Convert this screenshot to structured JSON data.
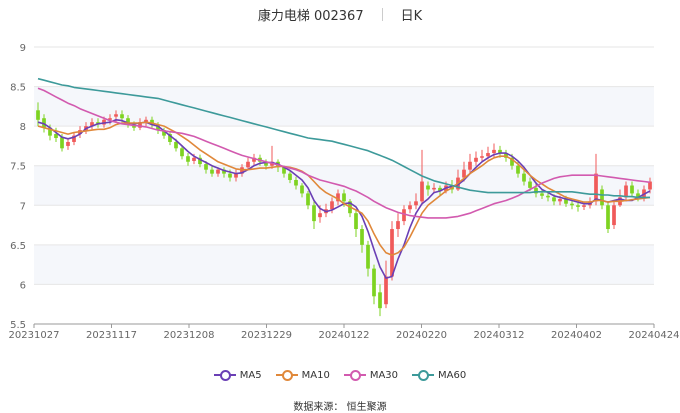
{
  "header": {
    "stock": "康力电梯 002367",
    "period": "日K"
  },
  "source": "数据来源： 恒生聚源",
  "chart_data": {
    "type": "candlestick",
    "y_ticks": [
      "5.5",
      "6",
      "6.5",
      "7",
      "7.5",
      "8",
      "8.5",
      "9"
    ],
    "ylim": [
      5.5,
      9
    ],
    "x_tick_labels": [
      "20231027",
      "20231117",
      "20231208",
      "20231229",
      "20240122",
      "20240220",
      "20240312",
      "20240402",
      "20240424"
    ],
    "colors": {
      "up": "#f05a5a",
      "down": "#7ed321",
      "MA5": "#6a3fb5",
      "MA10": "#e0883a",
      "MA30": "#d25aaf",
      "MA60": "#3d9a9a",
      "grid": "#e6e6e6",
      "band": "#f5f7fb"
    },
    "candles": [
      [
        8.2,
        8.08,
        8.3,
        8.0
      ],
      [
        8.1,
        7.98,
        8.15,
        7.92
      ],
      [
        7.98,
        7.88,
        8.02,
        7.82
      ],
      [
        7.9,
        7.85,
        7.98,
        7.8
      ],
      [
        7.86,
        7.72,
        7.9,
        7.68
      ],
      [
        7.75,
        7.8,
        7.85,
        7.7
      ],
      [
        7.8,
        7.88,
        7.92,
        7.76
      ],
      [
        7.9,
        7.95,
        8.0,
        7.85
      ],
      [
        7.95,
        8.0,
        8.05,
        7.9
      ],
      [
        8.0,
        8.05,
        8.1,
        7.96
      ],
      [
        8.05,
        8.02,
        8.1,
        7.98
      ],
      [
        8.02,
        8.08,
        8.12,
        7.98
      ],
      [
        8.08,
        8.1,
        8.15,
        8.02
      ],
      [
        8.12,
        8.15,
        8.2,
        8.05
      ],
      [
        8.15,
        8.1,
        8.2,
        8.05
      ],
      [
        8.1,
        8.02,
        8.14,
        7.98
      ],
      [
        8.02,
        7.98,
        8.06,
        7.94
      ],
      [
        7.98,
        8.05,
        8.1,
        7.95
      ],
      [
        8.05,
        8.08,
        8.12,
        8.0
      ],
      [
        8.08,
        8.02,
        8.12,
        7.98
      ],
      [
        8.02,
        7.95,
        8.05,
        7.9
      ],
      [
        7.95,
        7.88,
        7.98,
        7.84
      ],
      [
        7.9,
        7.8,
        7.92,
        7.76
      ],
      [
        7.8,
        7.72,
        7.84,
        7.68
      ],
      [
        7.72,
        7.62,
        7.75,
        7.58
      ],
      [
        7.62,
        7.55,
        7.66,
        7.5
      ],
      [
        7.56,
        7.6,
        7.65,
        7.52
      ],
      [
        7.6,
        7.52,
        7.64,
        7.48
      ],
      [
        7.52,
        7.45,
        7.56,
        7.4
      ],
      [
        7.45,
        7.4,
        7.5,
        7.36
      ],
      [
        7.4,
        7.45,
        7.48,
        7.36
      ],
      [
        7.45,
        7.4,
        7.48,
        7.35
      ],
      [
        7.4,
        7.35,
        7.45,
        7.3
      ],
      [
        7.35,
        7.4,
        7.45,
        7.3
      ],
      [
        7.4,
        7.48,
        7.52,
        7.36
      ],
      [
        7.48,
        7.55,
        7.6,
        7.44
      ],
      [
        7.55,
        7.6,
        7.65,
        7.5
      ],
      [
        7.6,
        7.55,
        7.64,
        7.5
      ],
      [
        7.55,
        7.5,
        7.58,
        7.45
      ],
      [
        7.5,
        7.55,
        7.75,
        7.46
      ],
      [
        7.55,
        7.48,
        7.58,
        7.42
      ],
      [
        7.48,
        7.4,
        7.5,
        7.35
      ],
      [
        7.4,
        7.32,
        7.44,
        7.28
      ],
      [
        7.32,
        7.25,
        7.36,
        7.2
      ],
      [
        7.25,
        7.15,
        7.28,
        7.1
      ],
      [
        7.15,
        7.0,
        7.18,
        6.95
      ],
      [
        7.0,
        6.8,
        7.05,
        6.7
      ],
      [
        6.85,
        6.9,
        7.0,
        6.78
      ],
      [
        6.9,
        6.95,
        7.02,
        6.85
      ],
      [
        6.95,
        7.05,
        7.1,
        6.9
      ],
      [
        7.05,
        7.15,
        7.2,
        7.0
      ],
      [
        7.15,
        7.05,
        7.2,
        6.98
      ],
      [
        7.05,
        6.9,
        7.08,
        6.85
      ],
      [
        6.9,
        6.7,
        6.95,
        6.6
      ],
      [
        6.7,
        6.5,
        6.75,
        6.4
      ],
      [
        6.5,
        6.2,
        6.55,
        6.1
      ],
      [
        6.2,
        5.85,
        6.25,
        5.75
      ],
      [
        5.9,
        5.7,
        6.0,
        5.6
      ],
      [
        5.75,
        6.1,
        6.3,
        5.7
      ],
      [
        6.1,
        6.7,
        6.8,
        6.05
      ],
      [
        6.7,
        6.8,
        6.9,
        6.6
      ],
      [
        6.8,
        6.95,
        7.0,
        6.75
      ],
      [
        6.95,
        7.0,
        7.05,
        6.9
      ],
      [
        7.0,
        7.05,
        7.15,
        6.95
      ],
      [
        7.05,
        7.3,
        7.7,
        7.0
      ],
      [
        7.25,
        7.2,
        7.3,
        7.12
      ],
      [
        7.2,
        7.22,
        7.28,
        7.15
      ],
      [
        7.22,
        7.18,
        7.25,
        7.12
      ],
      [
        7.18,
        7.25,
        7.3,
        7.15
      ],
      [
        7.25,
        7.2,
        7.32,
        7.15
      ],
      [
        7.2,
        7.35,
        7.45,
        7.18
      ],
      [
        7.35,
        7.45,
        7.55,
        7.3
      ],
      [
        7.45,
        7.55,
        7.65,
        7.4
      ],
      [
        7.55,
        7.6,
        7.68,
        7.5
      ],
      [
        7.6,
        7.62,
        7.7,
        7.55
      ],
      [
        7.62,
        7.66,
        7.74,
        7.58
      ],
      [
        7.66,
        7.7,
        7.78,
        7.6
      ],
      [
        7.7,
        7.66,
        7.75,
        7.6
      ],
      [
        7.66,
        7.6,
        7.7,
        7.55
      ],
      [
        7.6,
        7.5,
        7.65,
        7.45
      ],
      [
        7.5,
        7.4,
        7.55,
        7.35
      ],
      [
        7.4,
        7.3,
        7.45,
        7.25
      ],
      [
        7.3,
        7.22,
        7.35,
        7.18
      ],
      [
        7.22,
        7.15,
        7.28,
        7.1
      ],
      [
        7.15,
        7.12,
        7.2,
        7.08
      ],
      [
        7.12,
        7.1,
        7.16,
        7.05
      ],
      [
        7.1,
        7.05,
        7.14,
        7.0
      ],
      [
        7.05,
        7.08,
        7.12,
        7.0
      ],
      [
        7.08,
        7.02,
        7.12,
        6.98
      ],
      [
        7.02,
        7.0,
        7.06,
        6.95
      ],
      [
        7.0,
        6.98,
        7.05,
        6.92
      ],
      [
        6.98,
        7.0,
        7.04,
        6.94
      ],
      [
        7.0,
        7.05,
        7.1,
        6.96
      ],
      [
        7.05,
        7.4,
        7.65,
        7.0
      ],
      [
        7.2,
        7.0,
        7.25,
        6.95
      ],
      [
        7.0,
        6.7,
        7.05,
        6.65
      ],
      [
        6.75,
        7.0,
        7.05,
        6.7
      ],
      [
        7.0,
        7.1,
        7.2,
        6.98
      ],
      [
        7.1,
        7.25,
        7.3,
        7.05
      ],
      [
        7.25,
        7.15,
        7.3,
        7.1
      ],
      [
        7.15,
        7.1,
        7.2,
        7.05
      ],
      [
        7.1,
        7.2,
        7.25,
        7.05
      ],
      [
        7.2,
        7.3,
        7.35,
        7.15
      ]
    ],
    "series": [
      {
        "name": "MA5",
        "values": [
          8.05,
          8.03,
          7.98,
          7.92,
          7.86,
          7.84,
          7.86,
          7.9,
          7.97,
          8.0,
          8.03,
          8.04,
          8.05,
          8.08,
          8.07,
          8.04,
          8.03,
          8.04,
          8.05,
          8.02,
          8.0,
          7.94,
          7.88,
          7.82,
          7.75,
          7.68,
          7.62,
          7.58,
          7.54,
          7.5,
          7.47,
          7.44,
          7.42,
          7.4,
          7.41,
          7.45,
          7.5,
          7.53,
          7.54,
          7.54,
          7.52,
          7.48,
          7.44,
          7.38,
          7.32,
          7.22,
          7.06,
          6.96,
          6.92,
          6.94,
          6.98,
          7.02,
          7.03,
          6.98,
          6.86,
          6.67,
          6.44,
          6.22,
          6.08,
          6.1,
          6.32,
          6.5,
          6.72,
          6.9,
          7.02,
          7.08,
          7.16,
          7.18,
          7.22,
          7.24,
          7.26,
          7.32,
          7.4,
          7.48,
          7.55,
          7.6,
          7.64,
          7.66,
          7.66,
          7.62,
          7.56,
          7.48,
          7.38,
          7.28,
          7.2,
          7.16,
          7.12,
          7.1,
          7.08,
          7.06,
          7.04,
          7.02,
          7.02,
          7.08,
          7.06,
          7.04,
          7.06,
          7.08,
          7.06,
          7.06,
          7.1,
          7.14,
          7.18
        ]
      },
      {
        "name": "MA10",
        "values": [
          8.0,
          7.98,
          7.96,
          7.94,
          7.92,
          7.9,
          7.92,
          7.93,
          7.94,
          7.95,
          7.96,
          7.96,
          7.98,
          8.02,
          8.04,
          8.04,
          8.04,
          8.04,
          8.05,
          8.04,
          8.02,
          8.0,
          7.96,
          7.92,
          7.87,
          7.82,
          7.76,
          7.7,
          7.65,
          7.6,
          7.55,
          7.52,
          7.49,
          7.46,
          7.45,
          7.45,
          7.46,
          7.47,
          7.47,
          7.48,
          7.49,
          7.49,
          7.48,
          7.46,
          7.43,
          7.38,
          7.3,
          7.22,
          7.16,
          7.12,
          7.08,
          7.02,
          6.98,
          6.94,
          6.9,
          6.8,
          6.64,
          6.5,
          6.4,
          6.37,
          6.4,
          6.47,
          6.6,
          6.75,
          6.9,
          7.0,
          7.06,
          7.12,
          7.18,
          7.22,
          7.28,
          7.34,
          7.4,
          7.45,
          7.5,
          7.56,
          7.6,
          7.62,
          7.62,
          7.58,
          7.52,
          7.45,
          7.38,
          7.32,
          7.27,
          7.22,
          7.18,
          7.14,
          7.1,
          7.08,
          7.06,
          7.04,
          7.04,
          7.06,
          7.06,
          7.04,
          7.05,
          7.05,
          7.06,
          7.07,
          7.08,
          7.09,
          7.1
        ]
      },
      {
        "name": "MA30",
        "values": [
          8.48,
          8.45,
          8.41,
          8.37,
          8.33,
          8.29,
          8.26,
          8.22,
          8.19,
          8.16,
          8.13,
          8.1,
          8.07,
          8.05,
          8.03,
          8.02,
          8.01,
          8.0,
          7.99,
          7.97,
          7.95,
          7.94,
          7.93,
          7.92,
          7.91,
          7.89,
          7.87,
          7.84,
          7.81,
          7.78,
          7.75,
          7.72,
          7.69,
          7.66,
          7.63,
          7.61,
          7.59,
          7.57,
          7.55,
          7.53,
          7.51,
          7.49,
          7.47,
          7.45,
          7.42,
          7.38,
          7.35,
          7.32,
          7.3,
          7.28,
          7.26,
          7.24,
          7.21,
          7.18,
          7.14,
          7.1,
          7.05,
          7.01,
          6.97,
          6.94,
          6.91,
          6.89,
          6.87,
          6.86,
          6.85,
          6.84,
          6.84,
          6.84,
          6.84,
          6.85,
          6.86,
          6.88,
          6.9,
          6.93,
          6.96,
          6.99,
          7.02,
          7.04,
          7.06,
          7.09,
          7.12,
          7.16,
          7.2,
          7.24,
          7.28,
          7.31,
          7.34,
          7.36,
          7.37,
          7.38,
          7.38,
          7.38,
          7.38,
          7.38,
          7.37,
          7.36,
          7.35,
          7.34,
          7.33,
          7.32,
          7.31,
          7.3,
          7.29
        ]
      },
      {
        "name": "MA60",
        "values": [
          8.6,
          8.58,
          8.56,
          8.54,
          8.52,
          8.51,
          8.49,
          8.48,
          8.47,
          8.46,
          8.45,
          8.44,
          8.43,
          8.42,
          8.41,
          8.4,
          8.39,
          8.38,
          8.37,
          8.36,
          8.35,
          8.33,
          8.31,
          8.29,
          8.27,
          8.25,
          8.23,
          8.21,
          8.19,
          8.17,
          8.15,
          8.13,
          8.11,
          8.09,
          8.07,
          8.05,
          8.03,
          8.01,
          7.99,
          7.97,
          7.95,
          7.93,
          7.91,
          7.89,
          7.87,
          7.85,
          7.84,
          7.83,
          7.82,
          7.81,
          7.79,
          7.77,
          7.75,
          7.73,
          7.71,
          7.69,
          7.66,
          7.63,
          7.6,
          7.57,
          7.53,
          7.49,
          7.45,
          7.41,
          7.37,
          7.34,
          7.31,
          7.29,
          7.27,
          7.25,
          7.23,
          7.21,
          7.19,
          7.18,
          7.17,
          7.16,
          7.16,
          7.16,
          7.16,
          7.16,
          7.16,
          7.16,
          7.16,
          7.17,
          7.17,
          7.17,
          7.17,
          7.17,
          7.17,
          7.17,
          7.16,
          7.15,
          7.14,
          7.14,
          7.13,
          7.13,
          7.12,
          7.12,
          7.11,
          7.11,
          7.1,
          7.1,
          7.1
        ]
      }
    ]
  }
}
